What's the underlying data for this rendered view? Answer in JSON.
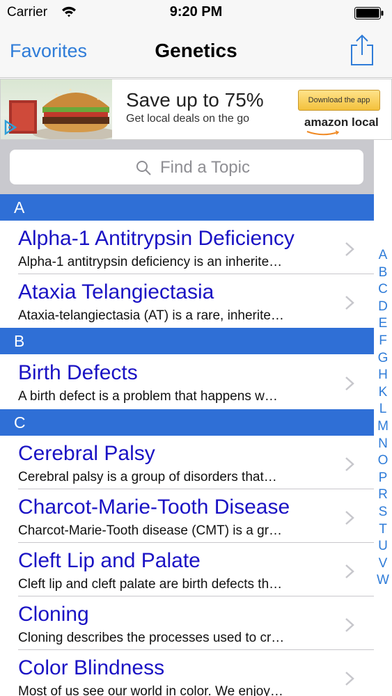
{
  "status_bar": {
    "carrier": "Carrier",
    "time": "9:20 PM"
  },
  "nav": {
    "back_label": "Favorites",
    "title": "Genetics",
    "share_icon": "share-icon"
  },
  "ad": {
    "headline": "Save up to 75%",
    "subline": "Get local deals on the go",
    "button_label": "Download the app",
    "brand": "amazon local"
  },
  "search": {
    "placeholder": "Find a Topic"
  },
  "sections": [
    {
      "letter": "A",
      "rows": [
        {
          "title": "Alpha-1 Antitrypsin Deficiency",
          "subtitle": "Alpha-1 antitrypsin deficiency is an inherite…"
        },
        {
          "title": "Ataxia Telangiectasia",
          "subtitle": "Ataxia-telangiectasia (AT) is a rare, inherite…"
        }
      ]
    },
    {
      "letter": "B",
      "rows": [
        {
          "title": "Birth Defects",
          "subtitle": "A birth defect is a problem that happens w…"
        }
      ]
    },
    {
      "letter": "C",
      "rows": [
        {
          "title": "Cerebral Palsy",
          "subtitle": "Cerebral palsy is a group of disorders that…"
        },
        {
          "title": "Charcot-Marie-Tooth Disease",
          "subtitle": "Charcot-Marie-Tooth disease (CMT) is a gr…"
        },
        {
          "title": "Cleft Lip and Palate",
          "subtitle": "Cleft lip and cleft palate are birth defects th…"
        },
        {
          "title": "Cloning",
          "subtitle": "Cloning describes the processes used to cr…"
        },
        {
          "title": "Color Blindness",
          "subtitle": "Most of us see our world in color. We enjoy…"
        }
      ]
    }
  ],
  "index_letters": [
    "A",
    "B",
    "C",
    "D",
    "E",
    "F",
    "G",
    "H",
    "K",
    "L",
    "M",
    "N",
    "O",
    "P",
    "R",
    "S",
    "T",
    "U",
    "V",
    "W"
  ],
  "colors": {
    "accent": "#2f7cd8",
    "section_header": "#2f6fd6",
    "row_title": "#1a12c4"
  }
}
